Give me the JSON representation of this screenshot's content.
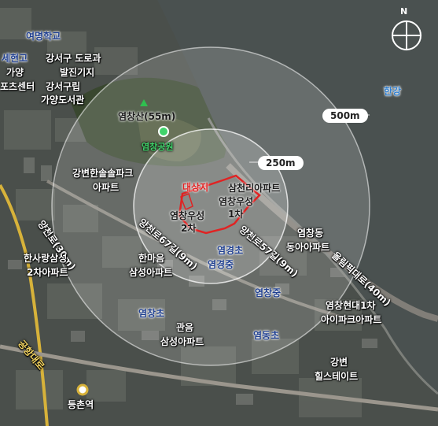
{
  "map": {
    "compass_label": "N",
    "compass_icon": "north-arrow-icon",
    "mountain_icon": "mountain-peak-icon",
    "park_icon": "park-circle-icon",
    "station_icon": "subway-station-icon",
    "colors": {
      "site_outline": "#e02323",
      "river": "#4a5150",
      "road": "#8f8a82",
      "station_road": "#d7b23a",
      "school_label": "#1f3f8f",
      "park_label": "#3fd36a"
    },
    "radii": {
      "inner": "250m",
      "outer": "500m"
    },
    "site": {
      "label": "대상지"
    },
    "labels": {
      "yeomyeong_school": "여명학교",
      "sehyeon": "세현고",
      "gayang": "가양",
      "sports_center": "포츠센터",
      "gangseo_depot_1": "강서구 도로과",
      "gangseo_depot_2": "발진기지",
      "gangseo_library_1": "강서구립",
      "gangseo_library_2": "가양도서관",
      "mountain": "염창산(55m)",
      "park": "염창공원",
      "hangang": "한강",
      "gangbyeon_1": "강변한솔솔파크",
      "gangbyeon_2": "아파트",
      "samcheonri_apt": "삼천리아파트",
      "woosung1_1": "염창우성",
      "woosung1_2": "1차",
      "woosung2_1": "염창우성",
      "woosung2_2": "2차",
      "road_yangcheon_30": "양천로(30m)",
      "road_yangcheon_67_9": "양천로67길(9m)",
      "road_yangcheon_57_9": "양천로57길(9m)",
      "road_olympic": "올림픽대로(40m)",
      "road_gonghang": "공항대로",
      "hansarang_1": "한사랑삼성",
      "hansarang_2": "2차아파트",
      "hanmaeum_1": "한마음",
      "hanmaeum_2": "삼성아파트",
      "yeomgyeong_elem": "염경초",
      "yeomgyeong_mid": "염경중",
      "yeomchang_mid": "염창중",
      "yeomchang_dong_1": "염창동",
      "yeomchang_dong_2": "동아아파트",
      "yeomchang_elem": "염창초",
      "hyundai_1": "염창현대1차",
      "hyundai_2": "아이파크아파트",
      "gwaneum_1": "관음",
      "gwaneum_2": "삼성아파트",
      "yeomdong_elem": "염동초",
      "hills_1": "강변",
      "hills_2": "힐스테이트",
      "deungchon_station": "등촌역"
    }
  }
}
